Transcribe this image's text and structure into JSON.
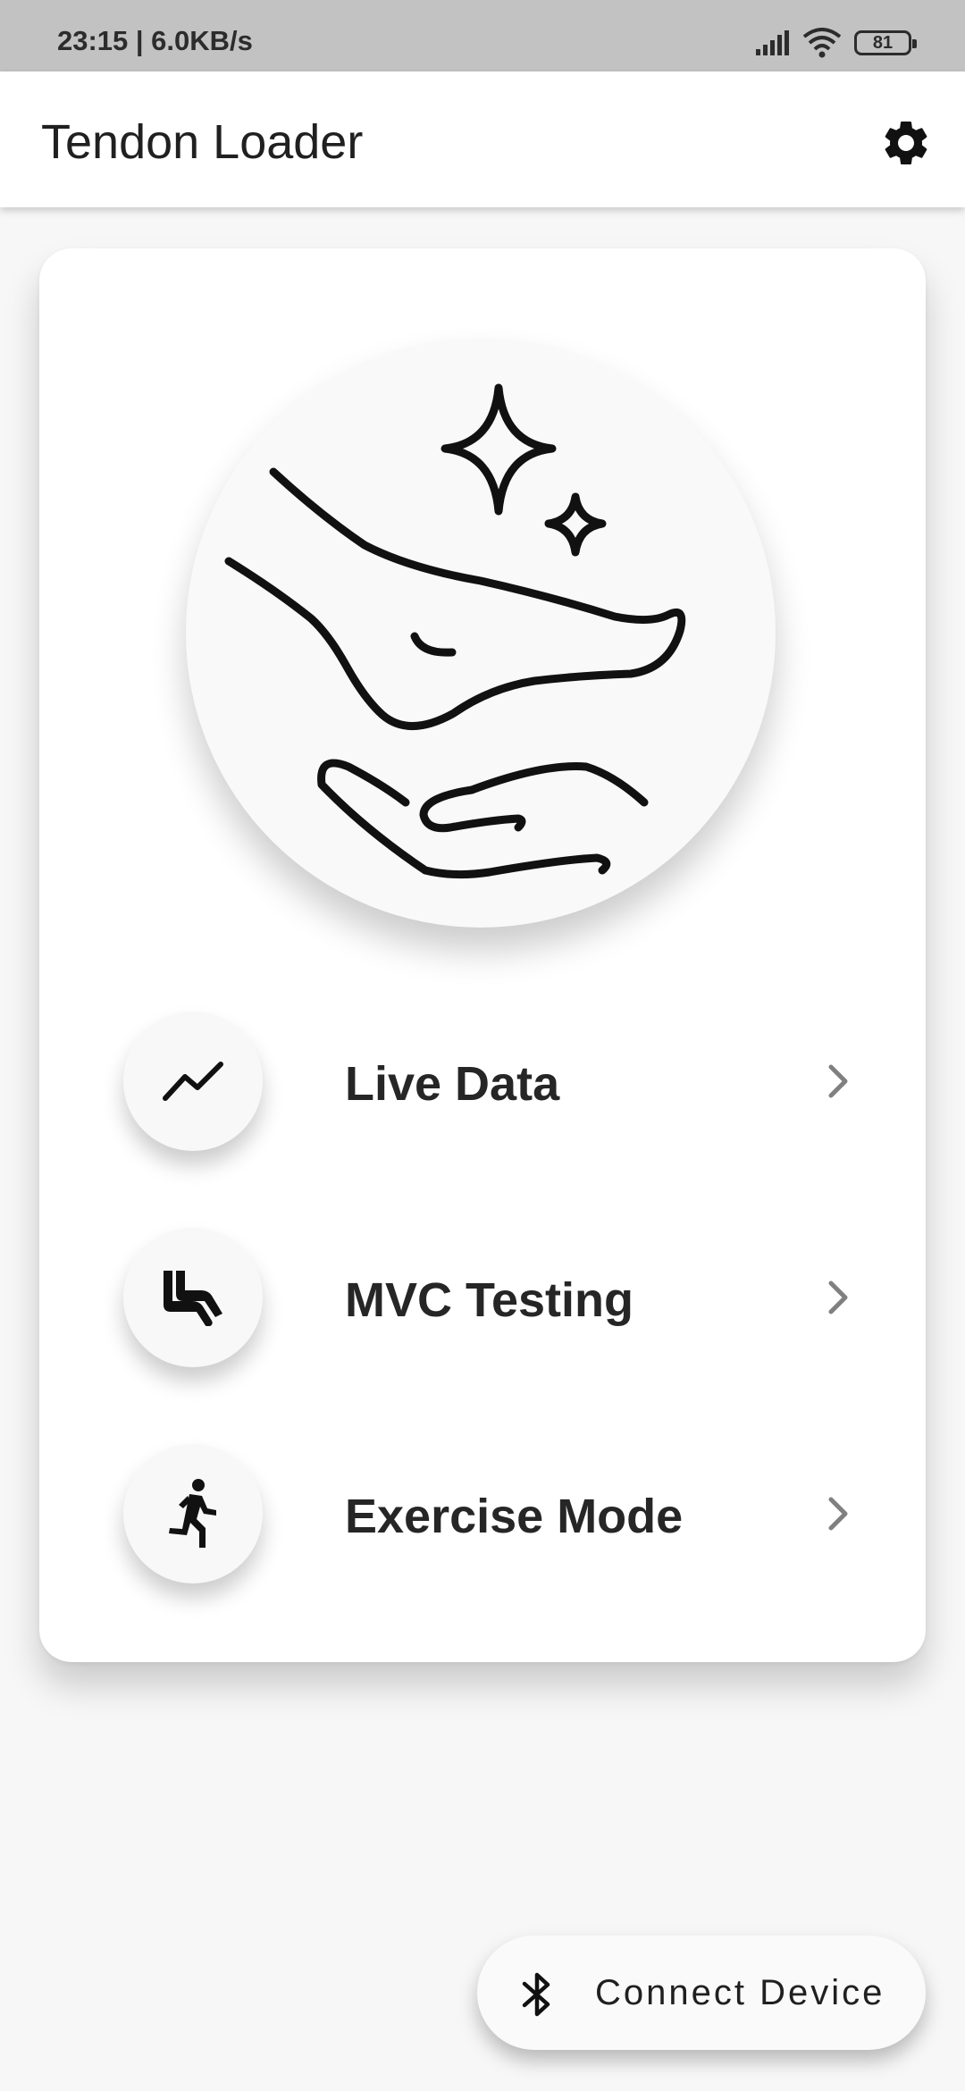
{
  "status_bar": {
    "time_speed": "23:15 | 6.0KB/s",
    "battery": "81",
    "icons": [
      "signal-icon",
      "wifi-icon",
      "battery-icon"
    ]
  },
  "app_bar": {
    "title": "Tendon Loader",
    "settings_icon": "gear-icon"
  },
  "hero": {
    "icon": "foot-hand-sparkle-illustration"
  },
  "menu": [
    {
      "label": "Live Data",
      "icon": "trending-line-icon"
    },
    {
      "label": "MVC Testing",
      "icon": "seat-leg-icon"
    },
    {
      "label": "Exercise Mode",
      "icon": "running-person-icon"
    }
  ],
  "fab": {
    "label": "Connect Device",
    "icon": "bluetooth-icon"
  },
  "colors": {
    "status_bar_bg": "#c2c2c2",
    "page_bg": "#f7f7f7",
    "card_bg": "#ffffff",
    "text": "#202020",
    "chevron": "#808080"
  }
}
